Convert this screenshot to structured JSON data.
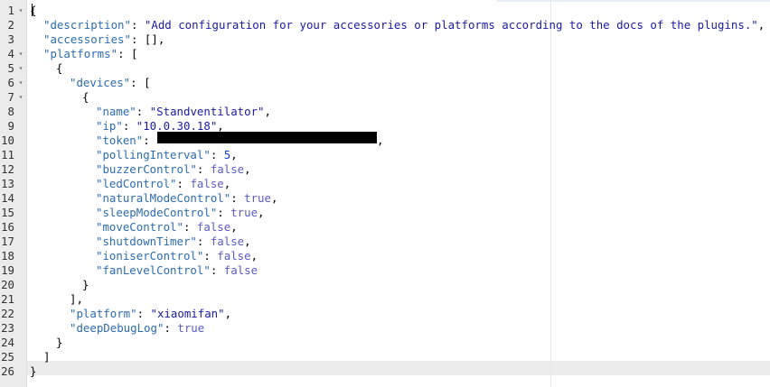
{
  "editor": {
    "line_numbers": [
      "1",
      "2",
      "3",
      "4",
      "5",
      "6",
      "7",
      "8",
      "9",
      "10",
      "11",
      "12",
      "13",
      "14",
      "15",
      "16",
      "17",
      "18",
      "19",
      "20",
      "21",
      "22",
      "23",
      "24",
      "25",
      "26"
    ],
    "fold_markers": {
      "1": "▾",
      "4": "▾",
      "5": "▾",
      "6": "▾",
      "7": "▾"
    },
    "lines": {
      "l1": "{",
      "l2_key": "\"description\"",
      "l2_val": "\"Add configuration for your accessories or platforms according to the docs of the plugins.\"",
      "l3_key": "\"accessories\"",
      "l3_val": "[]",
      "l4_key": "\"platforms\"",
      "l4_val": "[",
      "l5": "{",
      "l6_key": "\"devices\"",
      "l6_val": "[",
      "l7": "{",
      "l8_key": "\"name\"",
      "l8_val": "\"Standventilator\"",
      "l9_key": "\"ip\"",
      "l9_val": "\"10.0.30.18\"",
      "l10_key": "\"token\"",
      "l10_val": "\"",
      "l11_key": "\"pollingInterval\"",
      "l11_val": "5",
      "l12_key": "\"buzzerControl\"",
      "l12_val": "false",
      "l13_key": "\"ledControl\"",
      "l13_val": "false",
      "l14_key": "\"naturalModeControl\"",
      "l14_val": "true",
      "l15_key": "\"sleepModeControl\"",
      "l15_val": "true",
      "l16_key": "\"moveControl\"",
      "l16_val": "false",
      "l17_key": "\"shutdownTimer\"",
      "l17_val": "false",
      "l18_key": "\"ioniserControl\"",
      "l18_val": "false",
      "l19_key": "\"fanLevelControl\"",
      "l19_val": "false",
      "l20": "}",
      "l21": "],",
      "l22_key": "\"platform\"",
      "l22_val": "\"xiaomifan\"",
      "l23_key": "\"deepDebugLog\"",
      "l23_val": "true",
      "l24": "}",
      "l25": "]",
      "l26": "}"
    }
  },
  "colors": {
    "key": "#2c6cb3",
    "string": "#1a1aa6",
    "number": "#0b3fcf",
    "boolean": "#5a5ac8",
    "gutter": "#ebebeb",
    "active_line": "#ececec"
  }
}
